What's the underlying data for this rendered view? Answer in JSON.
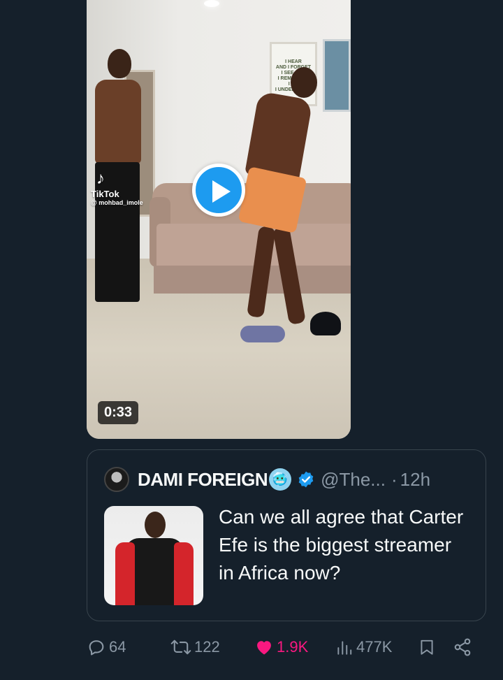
{
  "video": {
    "watermark_brand": "TikTok",
    "watermark_handle": "@ mohbad_imole",
    "wall_poster_text": [
      "I HEAR",
      "AND I FORGET",
      "I SEE AND",
      "I REMEMBER",
      "I DO",
      "I UNDERSTAND"
    ],
    "duration": "0:33"
  },
  "quoted_tweet": {
    "author_name": "DAMI FOREIGN",
    "name_emoji": "🥶",
    "handle": "@The...",
    "separator": "·",
    "time": "12h",
    "text": "Can we all agree that Carter Efe is the biggest streamer in Africa now?"
  },
  "actions": {
    "replies": "64",
    "retweets": "122",
    "likes": "1.9K",
    "views": "477K"
  },
  "colors": {
    "background": "#15202b",
    "accent": "#1d9bf0",
    "like": "#f91880",
    "muted": "#8b98a5"
  }
}
